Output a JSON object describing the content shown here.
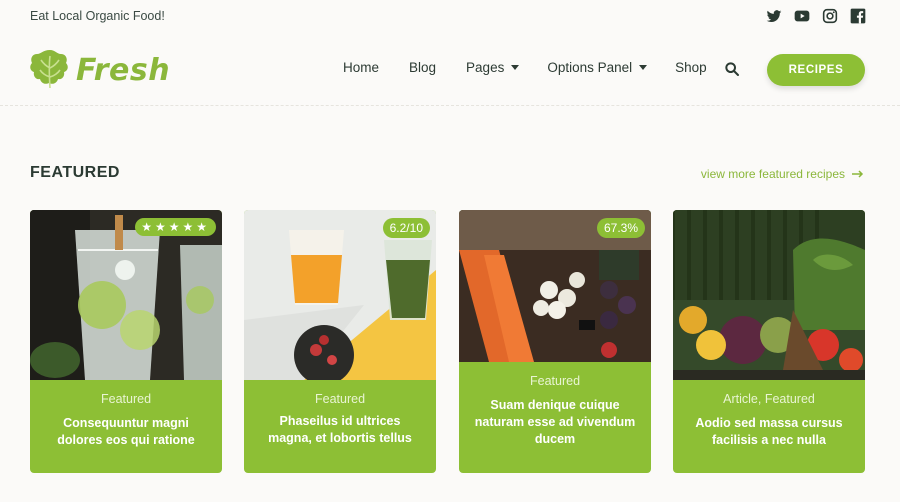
{
  "topbar": {
    "tagline": "Eat Local Organic Food!",
    "social": [
      "twitter-icon",
      "youtube-icon",
      "instagram-icon",
      "facebook-icon"
    ]
  },
  "brand": {
    "name": "Fresh",
    "color": "#8bb73b"
  },
  "nav": {
    "items": [
      {
        "label": "Home",
        "dropdown": false
      },
      {
        "label": "Blog",
        "dropdown": false
      },
      {
        "label": "Pages",
        "dropdown": true
      },
      {
        "label": "Options Panel",
        "dropdown": true
      },
      {
        "label": "Shop",
        "dropdown": false
      }
    ],
    "cta": "RECIPES"
  },
  "featured": {
    "title": "FEATURED",
    "view_more": "view more featured recipes",
    "cards": [
      {
        "badge": "★★★★★",
        "category": "Featured",
        "title": "Consequuntur magni dolores eos qui ratione"
      },
      {
        "badge": "6.2/10",
        "category": "Featured",
        "title": "Phaseilus id ultrices magna, et lobortis tellus"
      },
      {
        "badge": "67.3%",
        "category": "Featured",
        "title": "Suam denique cuique naturam esse ad vivendum ducem"
      },
      {
        "badge": "",
        "category": "Article, Featured",
        "title": "Aodio sed massa cursus facilisis a nec nulla"
      }
    ]
  },
  "colors": {
    "accent": "#8dbf35",
    "text": "#2b3a33",
    "background": "#fbfaf8"
  }
}
